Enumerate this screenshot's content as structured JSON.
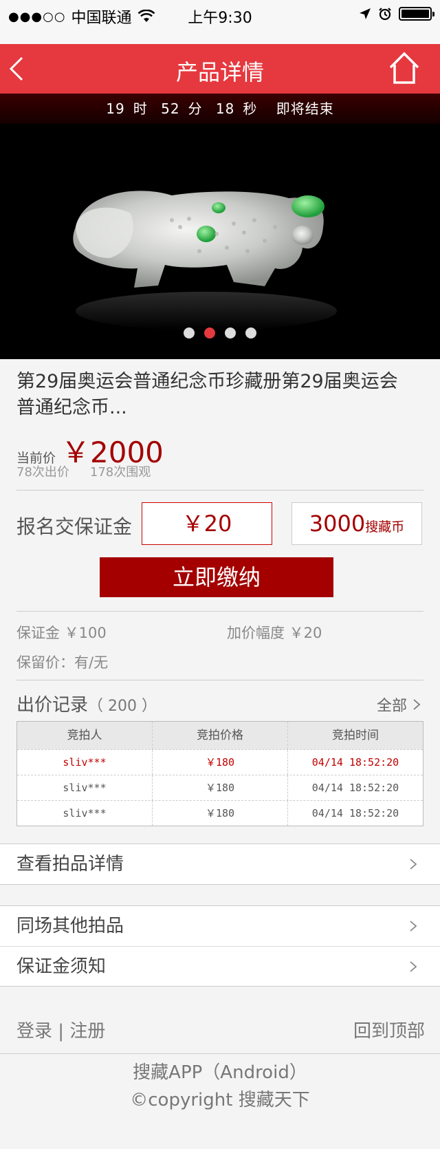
{
  "status_bar": {
    "signal": "●●●○○",
    "carrier": "中国联通",
    "time": "上午9:30"
  },
  "navbar": {
    "title": "产品详情"
  },
  "countdown": {
    "hours": "19",
    "hours_unit": "时",
    "minutes": "52",
    "minutes_unit": "分",
    "seconds": "18",
    "seconds_unit": "秒",
    "status": "即将结束"
  },
  "banner": {
    "slide_count": 4,
    "active_slide": 2
  },
  "product": {
    "title": "第29届奥运会普通纪念币珍藏册第29届奥运会普通纪念币...",
    "current_price_label": "当前价",
    "current_price": "￥2000",
    "bid_count": "78次出价",
    "view_count": "178次围观"
  },
  "deposit": {
    "label": "报名交保证金",
    "amount": "￥20",
    "coins": "3000",
    "coins_unit": "搜藏币",
    "pay_button": "立即缴纳"
  },
  "info": {
    "deposit": "保证金 ￥100",
    "increment": "加价幅度 ￥20",
    "reserve": "保留价：有/无"
  },
  "records": {
    "title": "出价记录",
    "count": "（ 200 ）",
    "all_label": "全部",
    "headers": [
      "竞拍人",
      "竞拍价格",
      "竞拍时间"
    ],
    "rows": [
      [
        "sliv***",
        "￥180",
        "04/14 18:52:20"
      ],
      [
        "sliv***",
        "￥180",
        "04/14 18:52:20"
      ],
      [
        "sliv***",
        "￥180",
        "04/14 18:52:20"
      ]
    ]
  },
  "menu": {
    "detail": "查看拍品详情",
    "others": "同场其他拍品",
    "deposit_notice": "保证金须知"
  },
  "footer": {
    "login": "登录",
    "separator": " | ",
    "register": "注册",
    "to_top": "回到顶部",
    "app_line": "搜藏APP（Android）",
    "copyright": "©copyright 搜藏天下"
  },
  "colors": {
    "brand_red": "#e5393f",
    "price_red": "#a40000"
  }
}
